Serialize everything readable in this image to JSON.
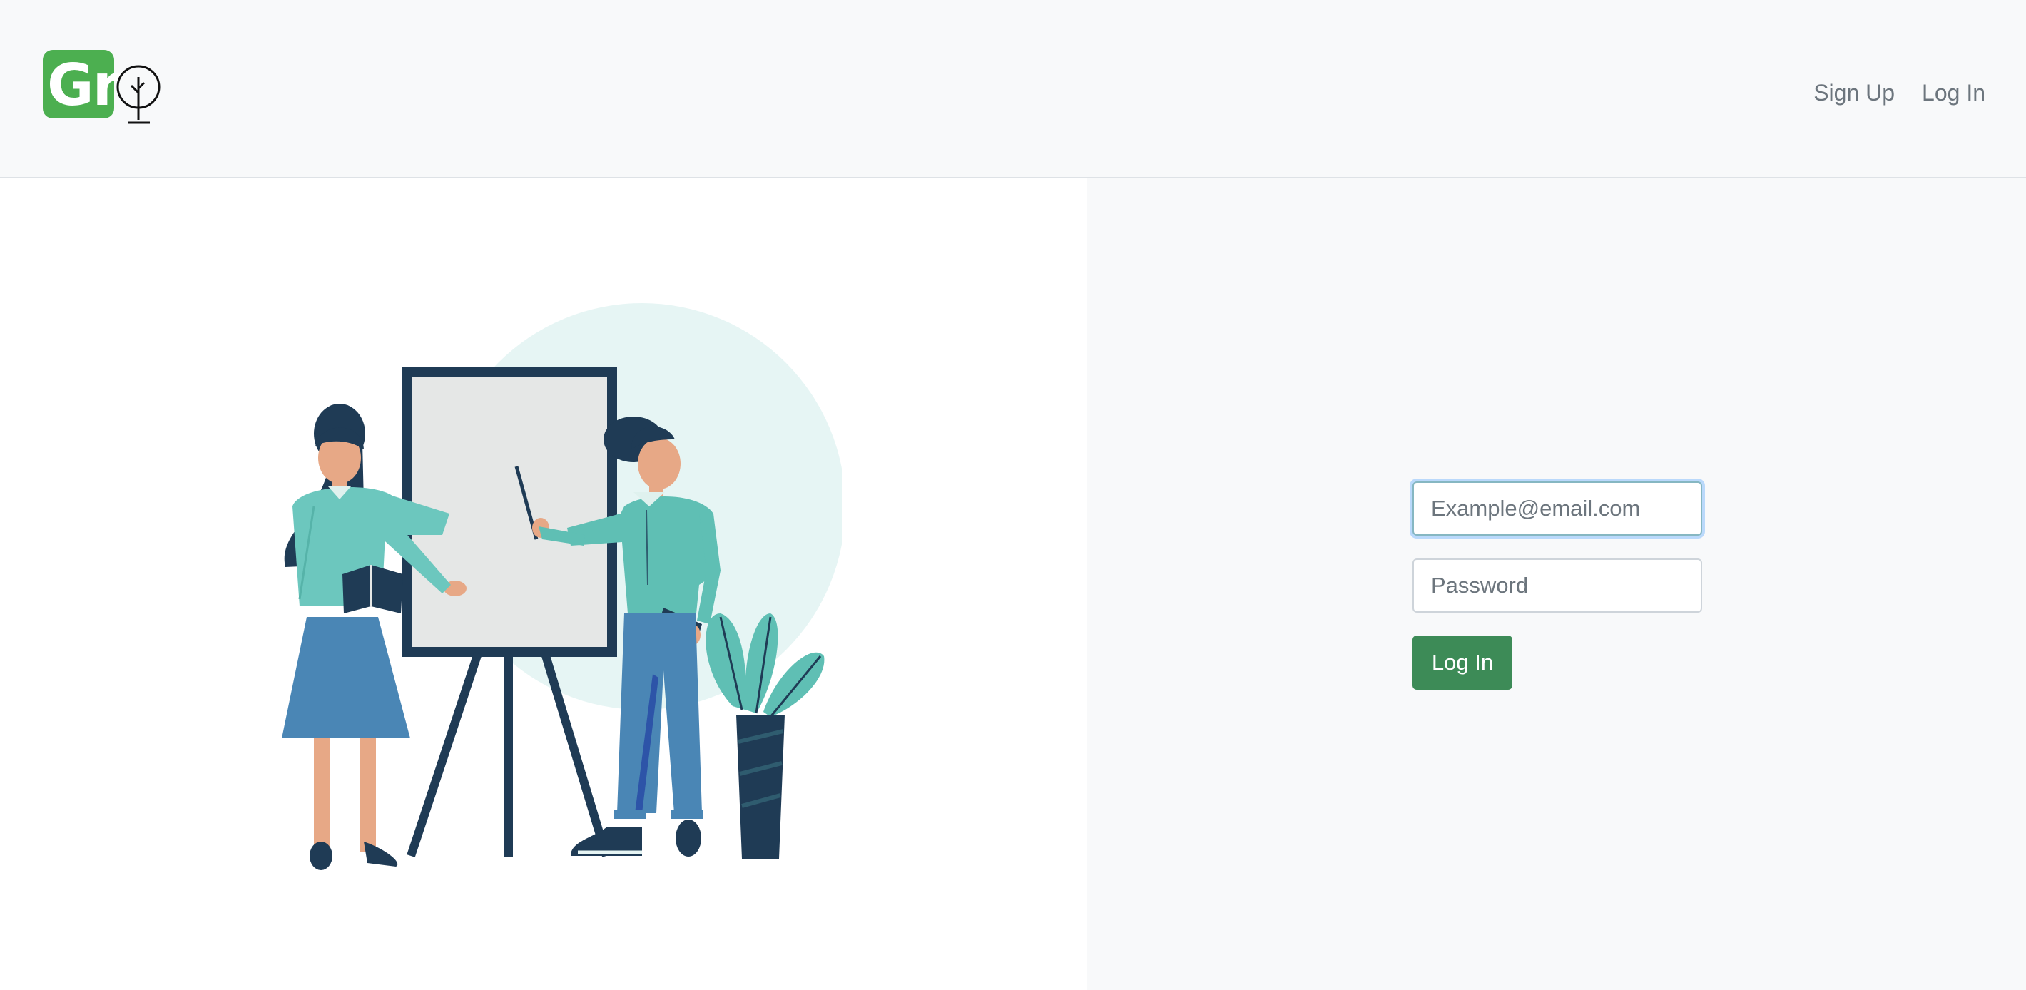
{
  "brand": {
    "logo_text": "Gr",
    "logo_color": "#4caf50",
    "tree_icon": "tree-icon"
  },
  "nav": {
    "links": [
      {
        "label": "Sign Up"
      },
      {
        "label": "Log In"
      }
    ]
  },
  "login_form": {
    "email_placeholder": "Example@email.com",
    "password_placeholder": "Password",
    "submit_label": "Log In",
    "submit_color": "#3d8b57"
  },
  "illustration": {
    "subject": "presentation-illustration"
  }
}
